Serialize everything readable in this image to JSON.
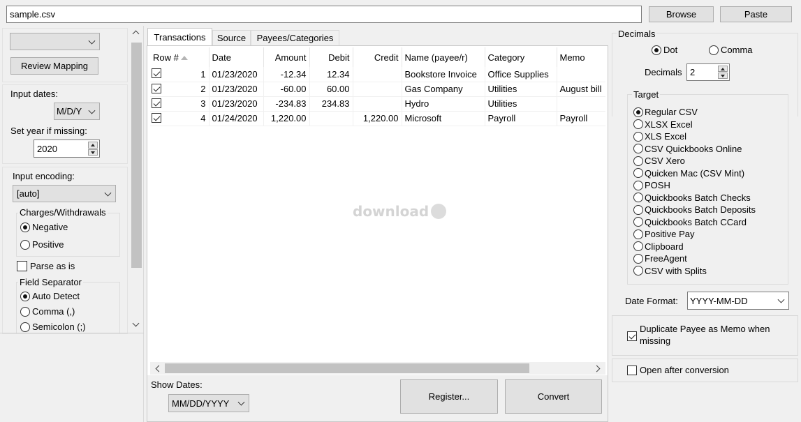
{
  "file": {
    "path": "sample.csv",
    "browse_label": "Browse",
    "paste_label": "Paste"
  },
  "left": {
    "mapping_select": "",
    "review_mapping_label": "Review Mapping",
    "input_dates_label": "Input dates:",
    "input_dates_value": "M/D/Y",
    "set_year_label": "Set year if missing:",
    "set_year_value": "2020",
    "encoding_label": "Input encoding:",
    "encoding_value": "[auto]",
    "charges_title": "Charges/Withdrawals",
    "charges_options": [
      "Negative",
      "Positive"
    ],
    "charges_selected": "Negative",
    "parse_as_is_label": "Parse as is",
    "separator_title": "Field Separator",
    "separator_options": [
      "Auto Detect",
      "Comma (,)",
      "Semicolon (;)"
    ],
    "separator_selected": "Auto Detect"
  },
  "tabs": [
    {
      "label": "Transactions",
      "active": true
    },
    {
      "label": "Source",
      "active": false
    },
    {
      "label": "Payees/Categories",
      "active": false
    }
  ],
  "table": {
    "columns": [
      "Row #",
      "Date",
      "Amount",
      "Debit",
      "Credit",
      "Name (payee/r)",
      "Category",
      "Memo"
    ],
    "rows": [
      {
        "checked": true,
        "row": "1",
        "date": "01/23/2020",
        "amount": "-12.34",
        "debit": "12.34",
        "credit": "",
        "name": "Bookstore Invoice",
        "category": "Office Supplies",
        "memo": ""
      },
      {
        "checked": true,
        "row": "2",
        "date": "01/23/2020",
        "amount": "-60.00",
        "debit": "60.00",
        "credit": "",
        "name": "Gas Company",
        "category": "Utilities",
        "memo": "August bill"
      },
      {
        "checked": true,
        "row": "3",
        "date": "01/23/2020",
        "amount": "-234.83",
        "debit": "234.83",
        "credit": "",
        "name": "Hydro",
        "category": "Utilities",
        "memo": ""
      },
      {
        "checked": true,
        "row": "4",
        "date": "01/24/2020",
        "amount": "1,220.00",
        "debit": "",
        "credit": "1,220.00",
        "name": "Microsoft",
        "category": "Payroll",
        "memo": "Payroll"
      }
    ]
  },
  "watermark": "download",
  "bottom": {
    "show_dates_label": "Show Dates:",
    "show_dates_value": "MM/DD/YYYY",
    "register_label": "Register...",
    "convert_label": "Convert"
  },
  "right": {
    "decimals_title": "Decimals",
    "decimal_options": [
      "Dot",
      "Comma"
    ],
    "decimal_selected": "Dot",
    "decimals_label": "Decimals",
    "decimals_value": "2",
    "target_title": "Target",
    "target_options": [
      "Regular CSV",
      "XLSX Excel",
      "XLS Excel",
      "CSV Quickbooks Online",
      "CSV Xero",
      "Quicken Mac (CSV Mint)",
      "POSH",
      "Quickbooks Batch Checks",
      "Quickbooks Batch Deposits",
      "Quickbooks Batch CCard",
      "Positive Pay",
      "Clipboard",
      "FreeAgent",
      "CSV with Splits"
    ],
    "target_selected": "Regular CSV",
    "date_format_label": "Date Format:",
    "date_format_value": "YYYY-MM-DD",
    "duplicate_payee_label": "Duplicate Payee as Memo when missing",
    "duplicate_payee_checked": true,
    "open_after_label": "Open after conversion",
    "open_after_checked": false
  }
}
